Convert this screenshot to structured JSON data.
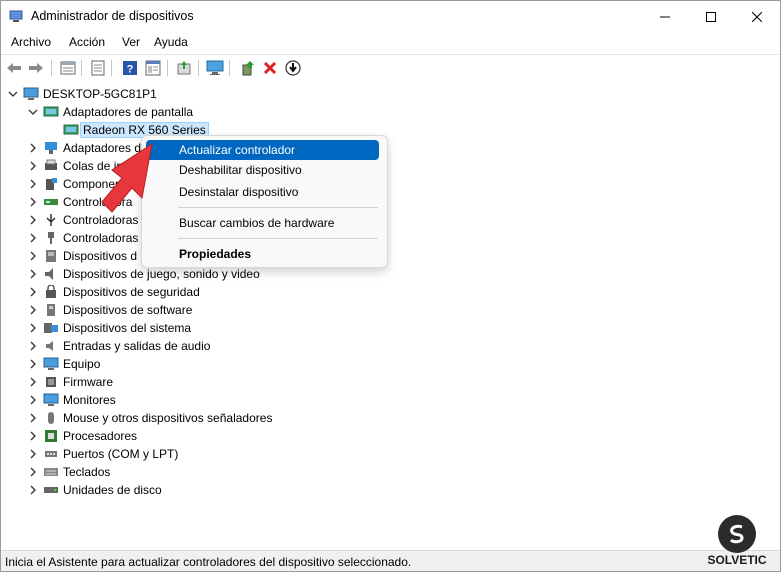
{
  "window": {
    "title": "Administrador de dispositivos"
  },
  "menu": [
    "Archivo",
    "Acción",
    "Ver",
    "Ayuda"
  ],
  "toolbar_icons": [
    "back-icon",
    "forward-icon",
    "show-hidden-icon",
    "properties-icon",
    "help-icon",
    "details-icon",
    "update-driver-icon",
    "monitor-icon",
    "add-driver-icon",
    "uninstall-icon",
    "download-icon"
  ],
  "tree": {
    "root": "DESKTOP-5GC81P1",
    "display_adapters": {
      "label": "Adaptadores de pantalla",
      "child": "Radeon RX 560 Series"
    },
    "categories": [
      "Adaptadores d",
      "Colas de impr",
      "Componentes",
      "Controladora",
      "Controladoras",
      "Controladoras",
      "Dispositivos d",
      "Dispositivos de juego, sonido y video",
      "Dispositivos de seguridad",
      "Dispositivos de software",
      "Dispositivos del sistema",
      "Entradas y salidas de audio",
      "Equipo",
      "Firmware",
      "Monitores",
      "Mouse y otros dispositivos señaladores",
      "Procesadores",
      "Puertos (COM y LPT)",
      "Teclados",
      "Unidades de disco"
    ]
  },
  "context_menu": {
    "update": "Actualizar controlador",
    "disable": "Deshabilitar dispositivo",
    "uninstall": "Desinstalar dispositivo",
    "scan": "Buscar cambios de hardware",
    "properties": "Propiedades"
  },
  "status": "Inicia el Asistente para actualizar controladores del dispositivo seleccionado.",
  "watermark": "SOLVETIC",
  "colors": {
    "accent": "#0067c0",
    "selection": "#cce8ff",
    "arrow": "#e8373c"
  }
}
